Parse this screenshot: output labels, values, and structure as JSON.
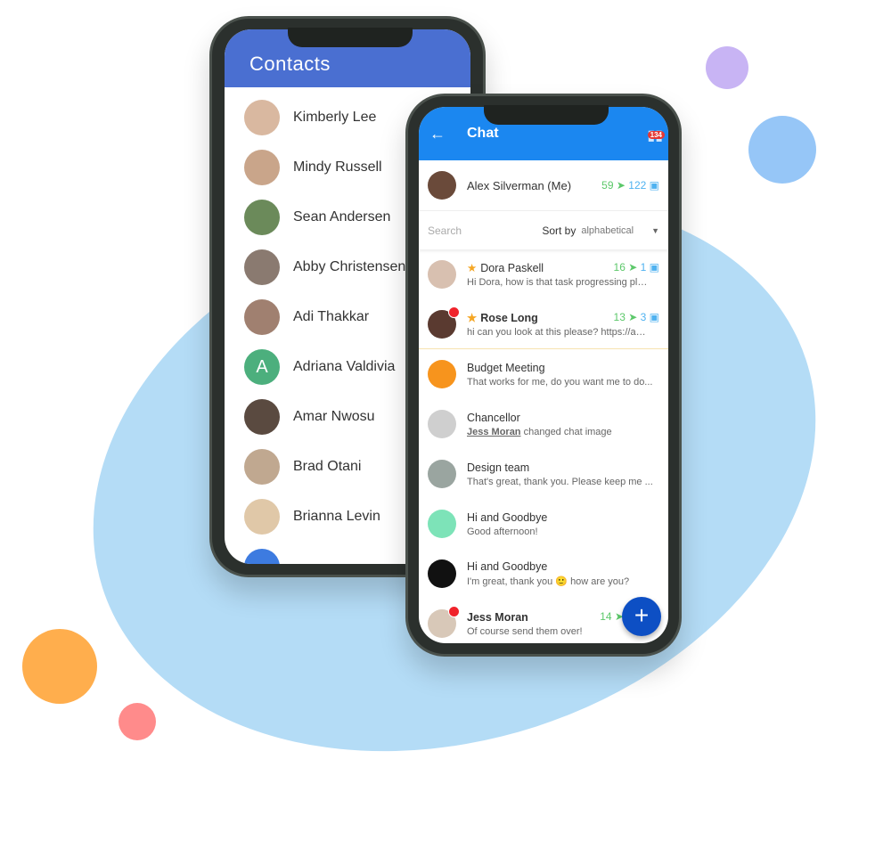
{
  "contacts_screen": {
    "title": "Contacts",
    "contacts": [
      {
        "name": "Kimberly Lee",
        "color": "#d9b8a0"
      },
      {
        "name": "Mindy Russell",
        "color": "#c9a58a"
      },
      {
        "name": "Sean Andersen",
        "color": "#6b8a5a"
      },
      {
        "name": "Abby Christensen",
        "color": "#8a7a70"
      },
      {
        "name": "Adi Thakkar",
        "color": "#a08070"
      },
      {
        "name": "Adriana Valdivia",
        "color": "#4caf7d",
        "initial": "A"
      },
      {
        "name": "Amar Nwosu",
        "color": "#5a4a40"
      },
      {
        "name": "Brad Otani",
        "color": "#c0a890"
      },
      {
        "name": "Brianna Levin",
        "color": "#e0c8a8"
      }
    ]
  },
  "chat_screen": {
    "title": "Chat",
    "notification_badge": "134",
    "me": {
      "name": "Alex Silverman (Me)",
      "sent": "59",
      "messages": "122"
    },
    "search_placeholder": "Search",
    "sort_label": "Sort by",
    "sort_value": "alphabetical",
    "chats": [
      {
        "name": "Dora Paskell",
        "preview": "Hi Dora, how is that task progressing ple...",
        "starred": true,
        "sent": "16",
        "messages": "1",
        "color": "#d8c0b0"
      },
      {
        "name": "Rose Long",
        "preview": "hi can you look at this please? https://app...",
        "starred": true,
        "bold": true,
        "unread": true,
        "sent": "13",
        "messages": "3",
        "color": "#5a3a30"
      },
      {
        "name": "Budget Meeting",
        "preview": "That works for me, do you want me to do...",
        "color": "#f7941d"
      },
      {
        "name": "Chancellor",
        "preview_user": "Jess Moran",
        "preview": "changed chat image",
        "color": "#cfcfcf"
      },
      {
        "name": "Design team",
        "preview": "That's great, thank you. Please keep me ...",
        "color": "#9aa5a0"
      },
      {
        "name": "Hi and Goodbye",
        "preview": "Good afternoon!",
        "color": "#7de3b8"
      },
      {
        "name": "Hi and Goodbye",
        "preview": "I'm great, thank you 🙂 how are you?",
        "color": "#111111"
      },
      {
        "name": "Jess Moran",
        "preview": "Of course send them over!",
        "bold": true,
        "unread": true,
        "sent": "14",
        "color": "#d8c8b8"
      }
    ],
    "fab_label": "+"
  },
  "colors": {
    "contacts_header": "#4a6fd1",
    "chat_header": "#1b87f0",
    "fab": "#0d4fc4",
    "blob": "#b4dcf6"
  }
}
